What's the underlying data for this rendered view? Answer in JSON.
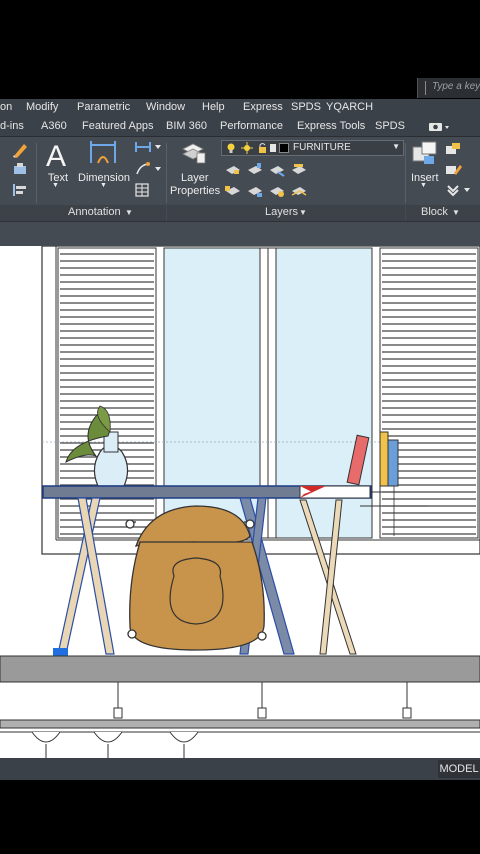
{
  "search": {
    "placeholder": "Type a keyw"
  },
  "menu": [
    "on",
    "Modify",
    "Parametric",
    "Window",
    "Help",
    "Express",
    "SPDS",
    "YQARCH"
  ],
  "tabs": [
    "d-ins",
    "A360",
    "Featured Apps",
    "BIM 360",
    "Performance",
    "Express Tools",
    "SPDS"
  ],
  "ribbon": {
    "text_label": "Text",
    "dimension_label": "Dimension",
    "layer_properties_label_1": "Layer",
    "layer_properties_label_2": "Properties",
    "current_layer": "FURNITURE",
    "insert_label": "Insert",
    "panels": {
      "annotation": "Annotation",
      "layers": "Layers",
      "block": "Block"
    }
  },
  "status": {
    "model_tab": "MODEL"
  },
  "colors": {
    "accent_blue": "#1f6fe0",
    "chair_fill": "#c8934a",
    "window_glass": "#dbeff8",
    "book_red": "#e86b6b",
    "book_yellow": "#f0c24a",
    "book_blue": "#6a9ed8"
  }
}
